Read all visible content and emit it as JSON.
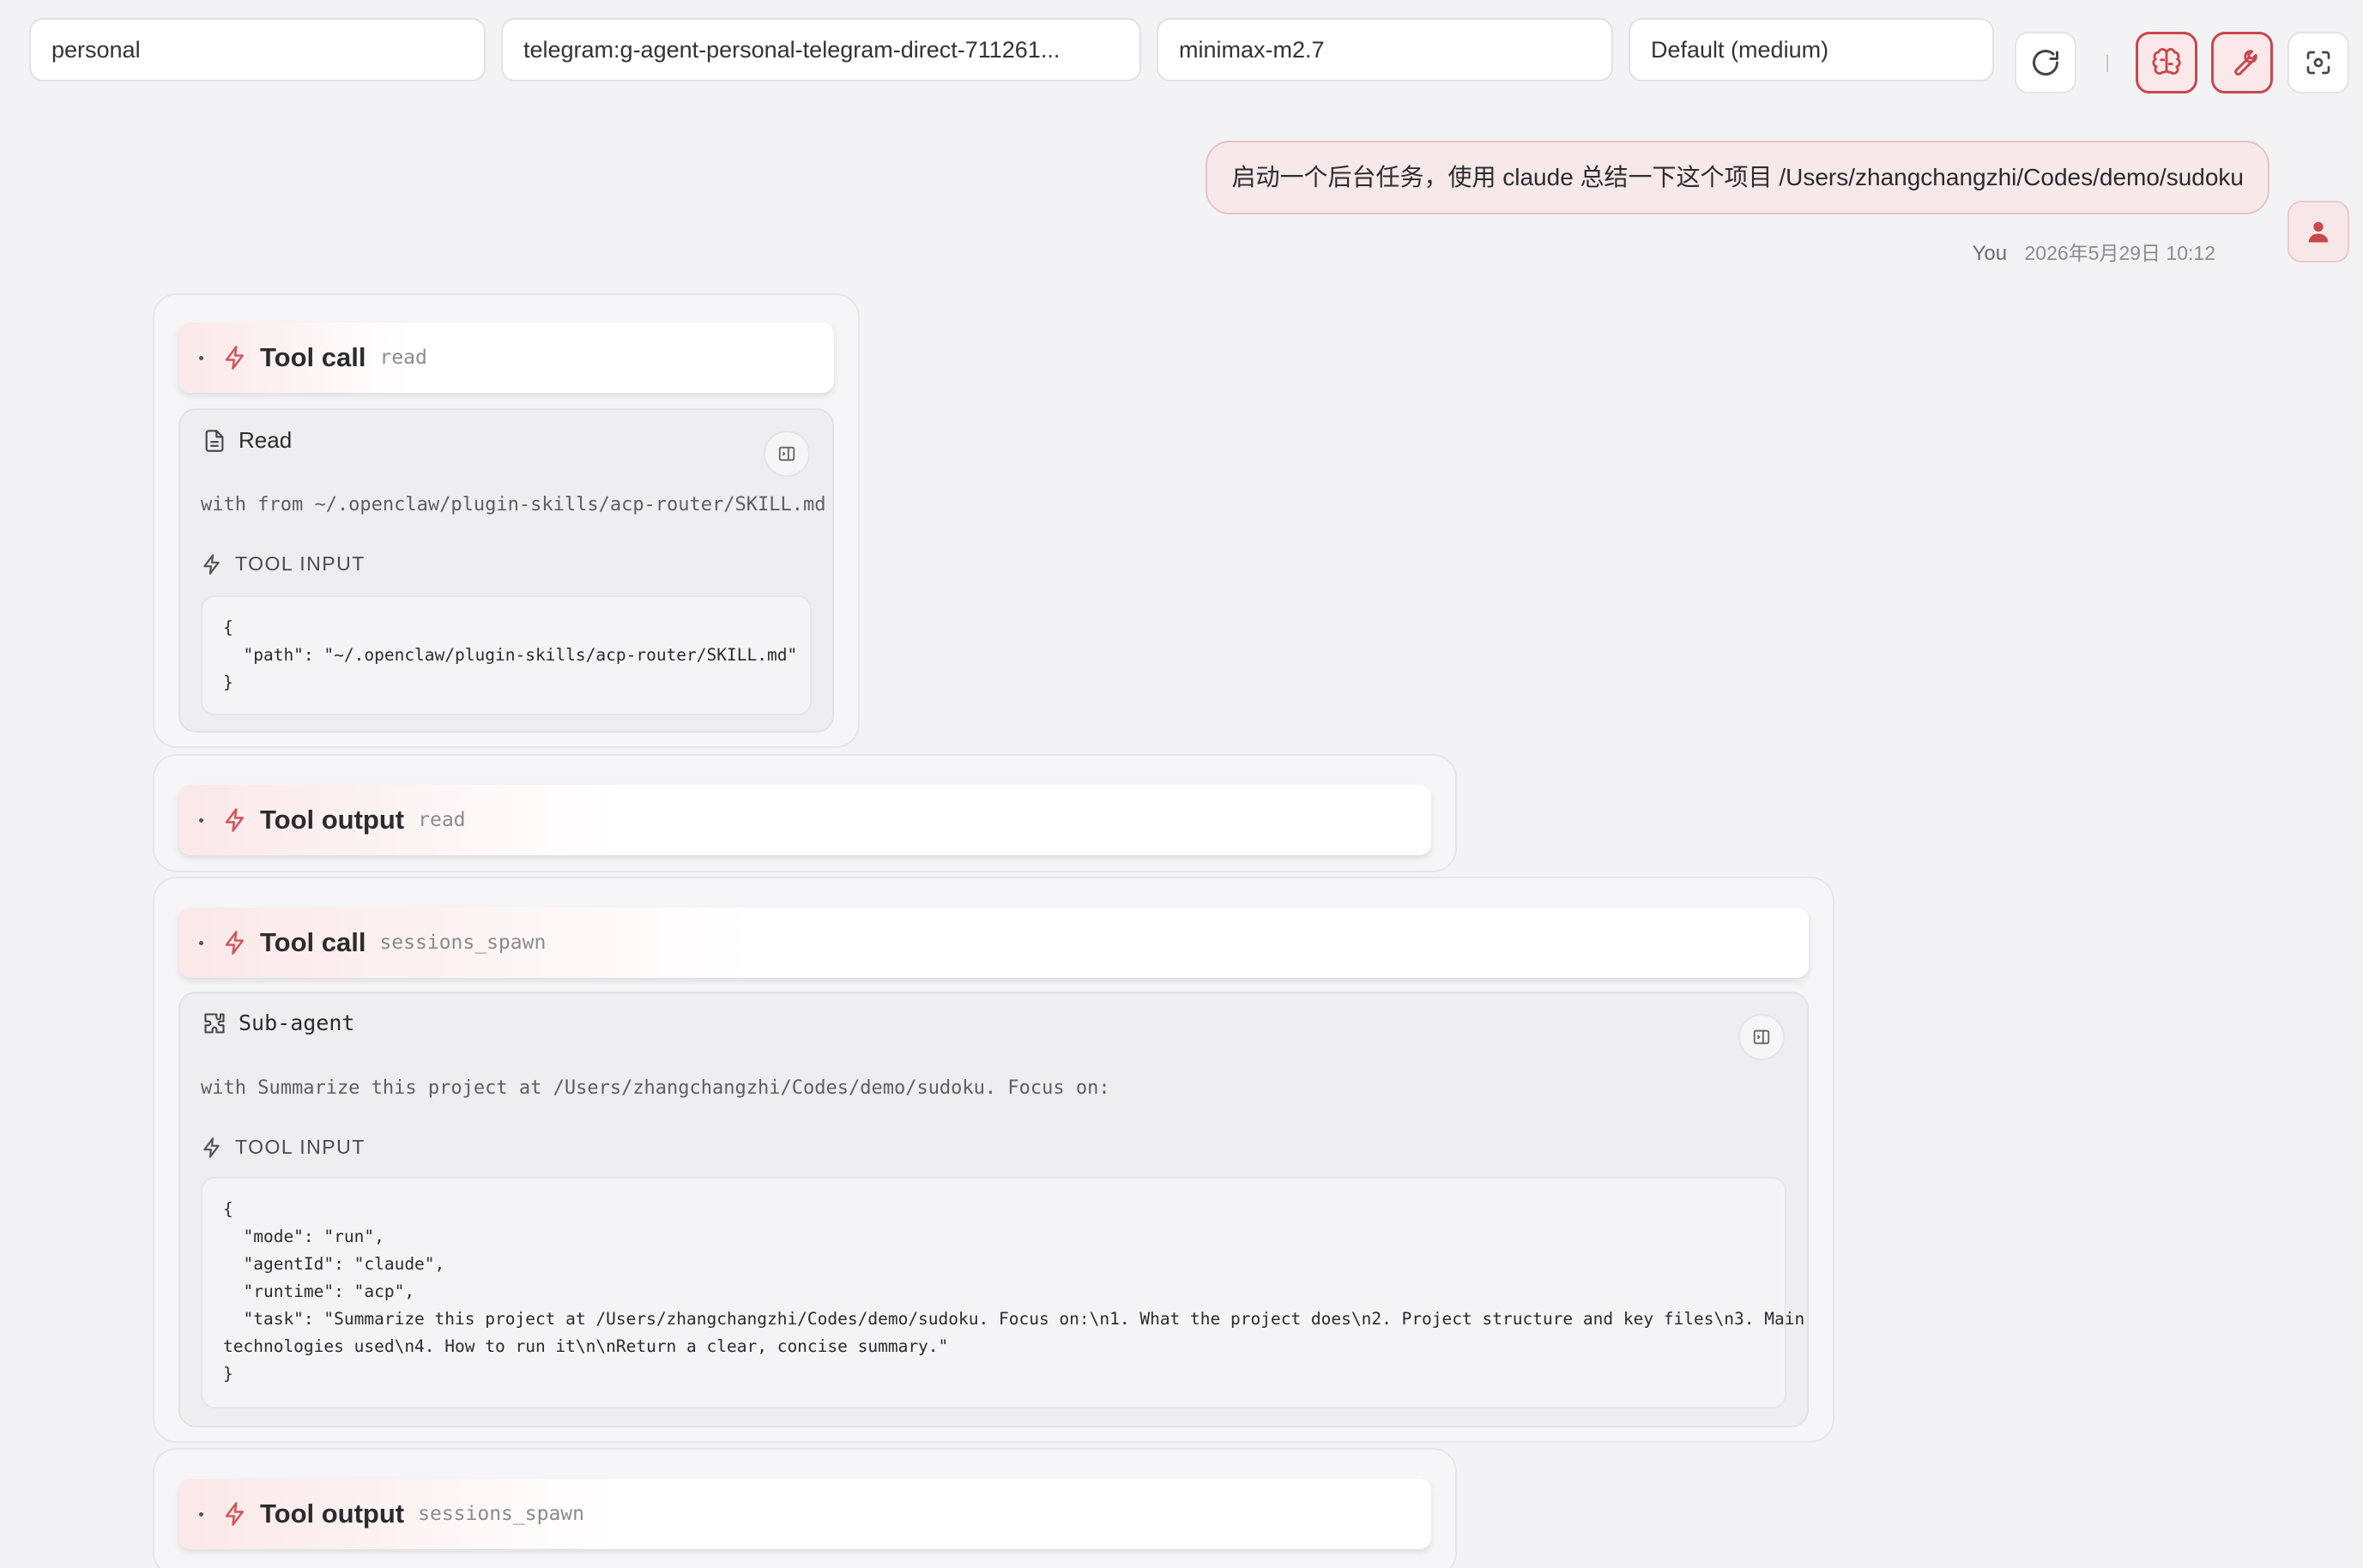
{
  "toolbar": {
    "agent_select": "personal",
    "session_select": "telegram:g-agent-personal-telegram-direct-711261...",
    "model_select": "minimax-m2.7",
    "thinking_select": "Default (medium)"
  },
  "user_message": {
    "text": "启动一个后台任务，使用 claude 总结一下这个项目 /Users/zhangchangzhi/Codes/demo/sudoku",
    "author": "You",
    "timestamp": "2026年5月29日 10:12"
  },
  "blocks": {
    "call1": {
      "title": "Tool call",
      "tool": "read",
      "body_label": "Read",
      "summary": "with from ~/.openclaw/plugin-skills/acp-router/SKILL.md",
      "input_label": "TOOL INPUT",
      "input_code": "{\n  \"path\": \"~/.openclaw/plugin-skills/acp-router/SKILL.md\"\n}"
    },
    "output1": {
      "title": "Tool output",
      "tool": "read"
    },
    "call2": {
      "title": "Tool call",
      "tool": "sessions_spawn",
      "body_label": "Sub-agent",
      "summary": "with Summarize this project at /Users/zhangchangzhi/Codes/demo/sudoku. Focus on:",
      "input_label": "TOOL INPUT",
      "input_code": "{\n  \"mode\": \"run\",\n  \"agentId\": \"claude\",\n  \"runtime\": \"acp\",\n  \"task\": \"Summarize this project at /Users/zhangchangzhi/Codes/demo/sudoku. Focus on:\\n1. What the project does\\n2. Project structure and key files\\n3. Main\ntechnologies used\\n4. How to run it\\n\\nReturn a clear, concise summary.\"\n}"
    },
    "output2": {
      "title": "Tool output",
      "tool": "sessions_spawn"
    }
  },
  "icons": {
    "refresh": "refresh-icon",
    "thinking": "brain-icon",
    "tools": "wrench-icon",
    "focus": "focus-icon",
    "avatar": "user-icon",
    "bolt": "lightning-icon",
    "file": "file-icon",
    "subagent": "puzzle-icon",
    "expand": "sidebar-expand-icon"
  },
  "colors": {
    "accent": "#c9474d",
    "background": "#f3f3f5",
    "user_bubble": "#f7e8e9"
  }
}
